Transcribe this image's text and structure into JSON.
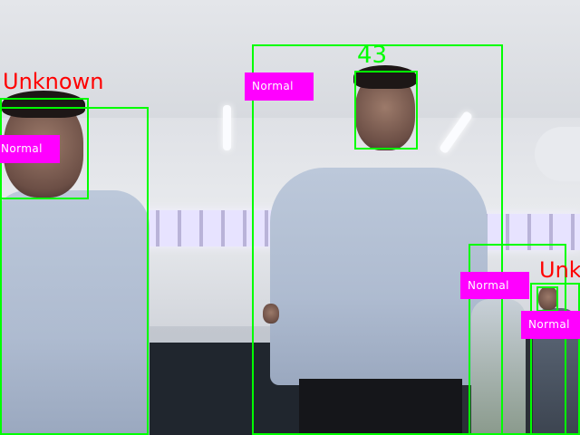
{
  "colors": {
    "box": "#00ff00",
    "tag": "#ff00ff",
    "tag_text": "#ffffff",
    "unknown_text": "#ff0000",
    "id_text": "#00ff00"
  },
  "detections": [
    {
      "person_label": "Unknown",
      "status": "Normal"
    },
    {
      "track_id": "43",
      "status": "Normal"
    },
    {
      "status": "Normal"
    },
    {
      "person_label": "Unknown",
      "status": "Normal"
    }
  ]
}
